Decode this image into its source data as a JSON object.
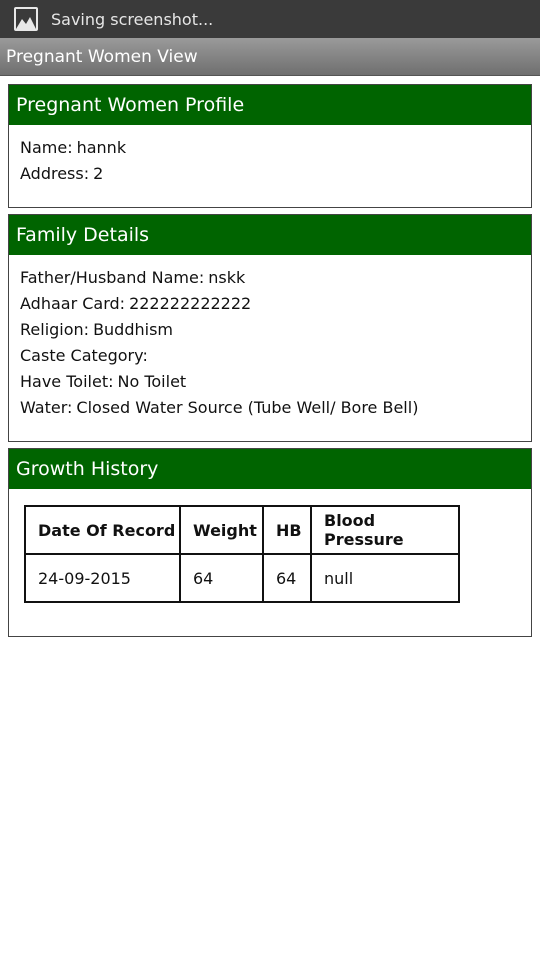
{
  "status_bar": {
    "icon": "image-icon",
    "text": "Saving screenshot..."
  },
  "title_bar": {
    "title": "Pregnant Women View"
  },
  "colors": {
    "header_green": "#006400",
    "status_bar": "#3a3a3a",
    "title_bar": "#808080"
  },
  "profile": {
    "header": "Pregnant Women Profile",
    "fields": [
      {
        "label": "Name:",
        "value": "hannk"
      },
      {
        "label": "Address:",
        "value": "2"
      }
    ]
  },
  "family": {
    "header": "Family Details",
    "fields": [
      {
        "label": "Father/Husband Name:",
        "value": "nskk"
      },
      {
        "label": "Adhaar Card:",
        "value": "222222222222"
      },
      {
        "label": "Religion:",
        "value": "Buddhism"
      },
      {
        "label": "Caste Category:",
        "value": ""
      },
      {
        "label": "Have Toilet:",
        "value": "No Toilet"
      },
      {
        "label": "Water:",
        "value": "Closed Water Source (Tube Well/ Bore Bell)"
      }
    ]
  },
  "growth": {
    "header": "Growth History",
    "columns": [
      "Date Of Record",
      "Weight",
      "HB",
      "Blood Pressure"
    ],
    "rows": [
      [
        "24-09-2015",
        "64",
        "64",
        "null"
      ]
    ]
  }
}
